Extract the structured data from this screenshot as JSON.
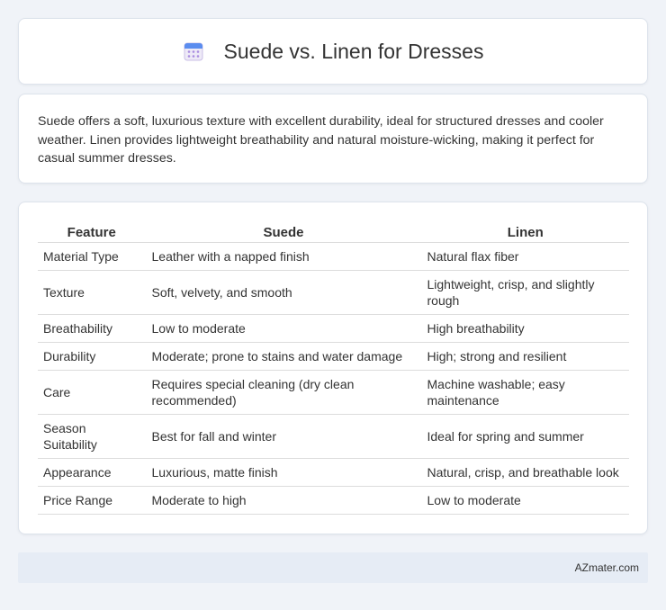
{
  "header": {
    "title": "Suede vs. Linen for Dresses",
    "icon": "calendar-icon"
  },
  "summary": {
    "text": "Suede offers a soft, luxurious texture with excellent durability, ideal for structured dresses and cooler weather. Linen provides lightweight breathability and natural moisture-wicking, making it perfect for casual summer dresses."
  },
  "table": {
    "headers": [
      "Feature",
      "Suede",
      "Linen"
    ],
    "rows": [
      [
        "Material Type",
        "Leather with a napped finish",
        "Natural flax fiber"
      ],
      [
        "Texture",
        "Soft, velvety, and smooth",
        "Lightweight, crisp, and slightly rough"
      ],
      [
        "Breathability",
        "Low to moderate",
        "High breathability"
      ],
      [
        "Durability",
        "Moderate; prone to stains and water damage",
        "High; strong and resilient"
      ],
      [
        "Care",
        "Requires special cleaning (dry clean recommended)",
        "Machine washable; easy maintenance"
      ],
      [
        "Season Suitability",
        "Best for fall and winter",
        "Ideal for spring and summer"
      ],
      [
        "Appearance",
        "Luxurious, matte finish",
        "Natural, crisp, and breathable look"
      ],
      [
        "Price Range",
        "Moderate to high",
        "Low to moderate"
      ]
    ]
  },
  "footer": {
    "text": "AZmater.com"
  }
}
